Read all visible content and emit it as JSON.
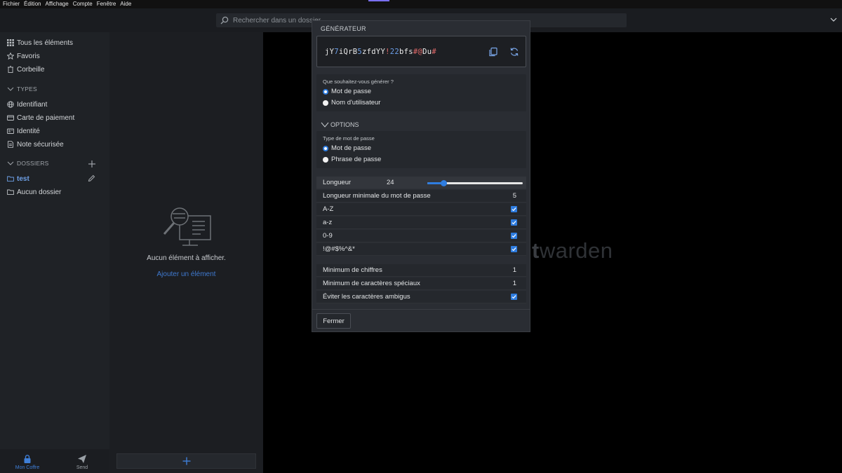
{
  "menu": [
    "Fichier",
    "Édition",
    "Affichage",
    "Compte",
    "Fenêtre",
    "Aide"
  ],
  "search": {
    "placeholder": "Rechercher dans un dossier"
  },
  "sidebar": {
    "all_items": "Tous les éléments",
    "favorites": "Favoris",
    "trash": "Corbeille",
    "types_header": "TYPES",
    "types": [
      "Identifiant",
      "Carte de paiement",
      "Identité",
      "Note sécurisée"
    ],
    "folders_header": "DOSSIERS",
    "folders": [
      "test",
      "Aucun dossier"
    ]
  },
  "bottom_nav": {
    "vault": "Mon Coffre",
    "send": "Send"
  },
  "list": {
    "empty_text": "Aucun élément à afficher.",
    "add_link": "Ajouter un élément"
  },
  "brand": {
    "text_bold": "t",
    "text_rest": "warden"
  },
  "generator": {
    "title": "GÉNÉRATEUR",
    "password_segments": [
      {
        "t": "jY",
        "k": "a"
      },
      {
        "t": "7",
        "k": "n"
      },
      {
        "t": "iQrB",
        "k": "a"
      },
      {
        "t": "5",
        "k": "n"
      },
      {
        "t": "zfdYY",
        "k": "a"
      },
      {
        "t": "!",
        "k": "s"
      },
      {
        "t": "22",
        "k": "n"
      },
      {
        "t": "bfs",
        "k": "a"
      },
      {
        "t": "#@",
        "k": "s"
      },
      {
        "t": "Du",
        "k": "a"
      },
      {
        "t": "#",
        "k": "s"
      }
    ],
    "what_question": "Que souhaitez-vous générer ?",
    "what_options": [
      "Mot de passe",
      "Nom d'utilisateur"
    ],
    "options_header": "OPTIONS",
    "type_question": "Type de mot de passe",
    "type_options": [
      "Mot de passe",
      "Phrase de passe"
    ],
    "length_label": "Longueur",
    "length_value": "24",
    "length_slider_fraction": 0.17,
    "min_length_label": "Longueur minimale du mot de passe",
    "min_length_value": "5",
    "charsets": [
      "A-Z",
      "a-z",
      "0-9",
      "!@#$%^&*"
    ],
    "min_numbers_label": "Minimum de chiffres",
    "min_numbers_value": "1",
    "min_special_label": "Minimum de caractères spéciaux",
    "min_special_value": "1",
    "avoid_ambiguous_label": "Éviter les caractères ambigus",
    "close_label": "Fermer"
  }
}
